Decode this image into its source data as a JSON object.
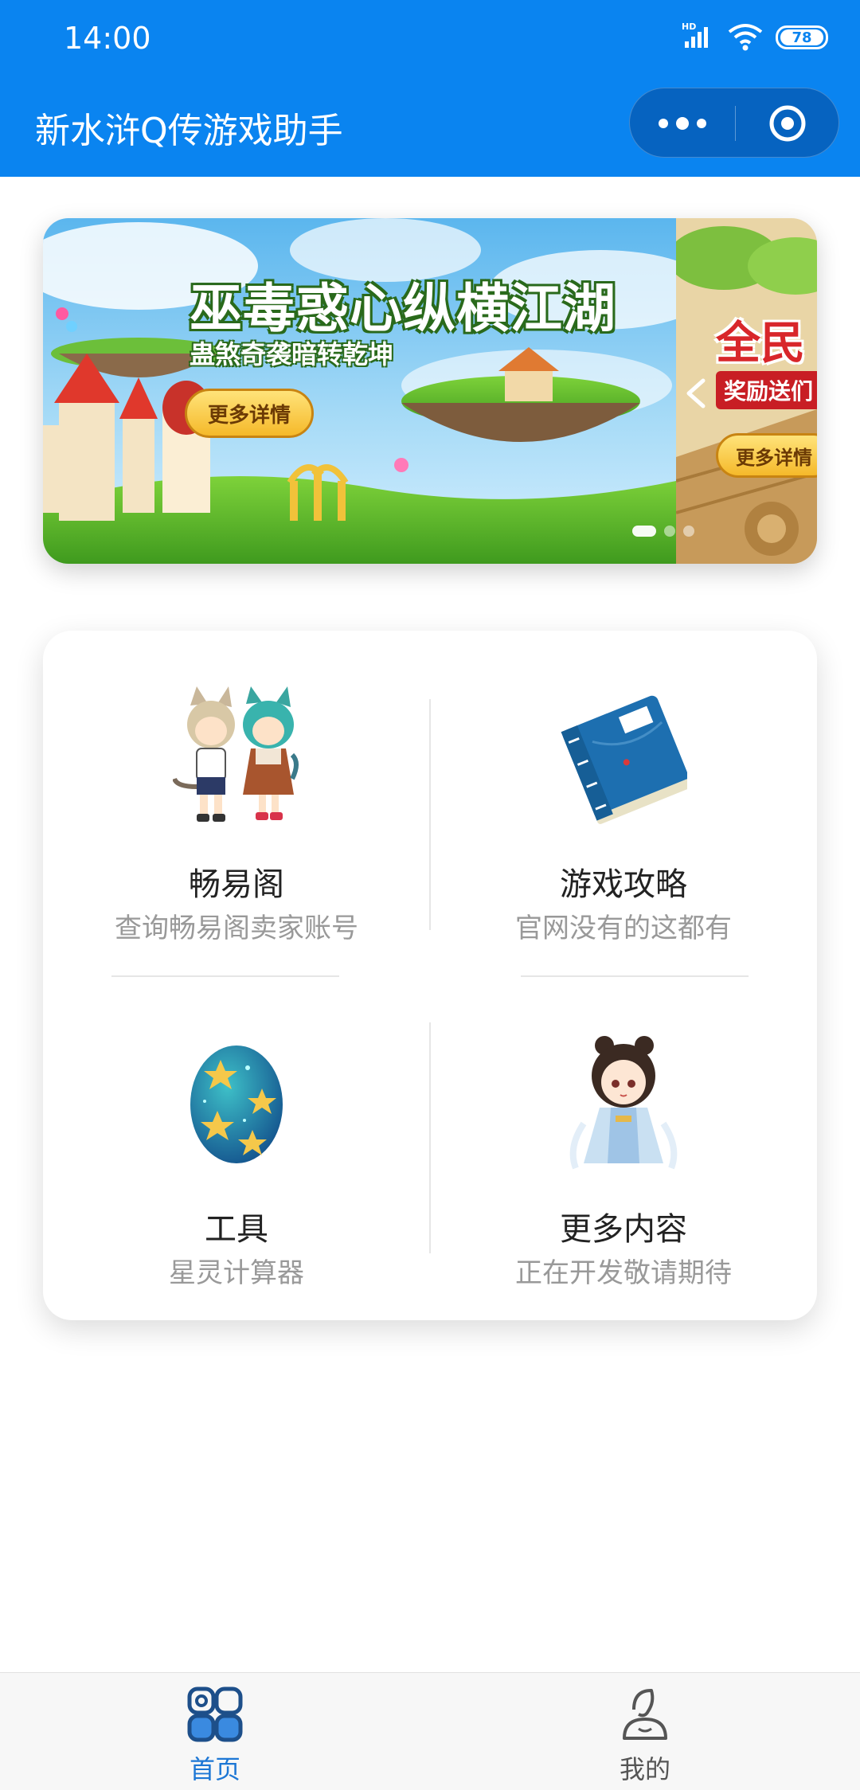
{
  "status_bar": {
    "time": "14:00",
    "network_label": "HD",
    "battery": "78"
  },
  "nav": {
    "title": "新水浒Q传游戏助手",
    "more_icon": "more-dots-icon",
    "close_icon": "target-circle-icon"
  },
  "banner": {
    "slides": [
      {
        "headline": "巫毒惑心纵横江湖",
        "subline": "蛊煞奇袭暗转乾坤",
        "button": "更多详情"
      },
      {
        "headline": "全民",
        "subline": "奖励送们",
        "button": "更多详情"
      }
    ],
    "active_slide": 1,
    "slide_count": 3
  },
  "menu": {
    "items": [
      {
        "title": "畅易阁",
        "desc": "查询畅易阁卖家账号",
        "icon": "cat-ear-couple-icon"
      },
      {
        "title": "游戏攻略",
        "desc": "官网没有的这都有",
        "icon": "blue-book-icon"
      },
      {
        "title": "工具",
        "desc": "星灵计算器",
        "icon": "star-egg-icon"
      },
      {
        "title": "更多内容",
        "desc": "正在开发敬请期待",
        "icon": "chibi-lady-icon"
      }
    ]
  },
  "tabbar": {
    "items": [
      {
        "label": "首页",
        "icon": "home-grid-icon",
        "active": true,
        "color": "#1d77d5"
      },
      {
        "label": "我的",
        "icon": "user-profile-icon",
        "active": false,
        "color": "#555555"
      }
    ]
  },
  "colors": {
    "header_bg": "#0a84f0",
    "capsule_bg": "#0663c0",
    "accent": "#1d77d5"
  }
}
